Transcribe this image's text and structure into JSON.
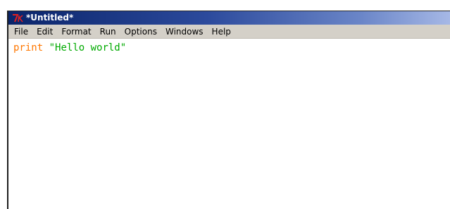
{
  "window": {
    "title": "*Untitled*"
  },
  "menu": {
    "items": [
      "File",
      "Edit",
      "Format",
      "Run",
      "Options",
      "Windows",
      "Help"
    ]
  },
  "editor": {
    "line1": {
      "keyword": "print",
      "space": " ",
      "string": "\"Hello world\""
    }
  },
  "colors": {
    "keyword": "#ff7700",
    "string": "#00aa00",
    "titlebar_start": "#0a246a",
    "titlebar_end": "#a6b8e6",
    "menubar": "#d4d0c8"
  },
  "icons": {
    "app_icon": "tk-feather-icon"
  }
}
